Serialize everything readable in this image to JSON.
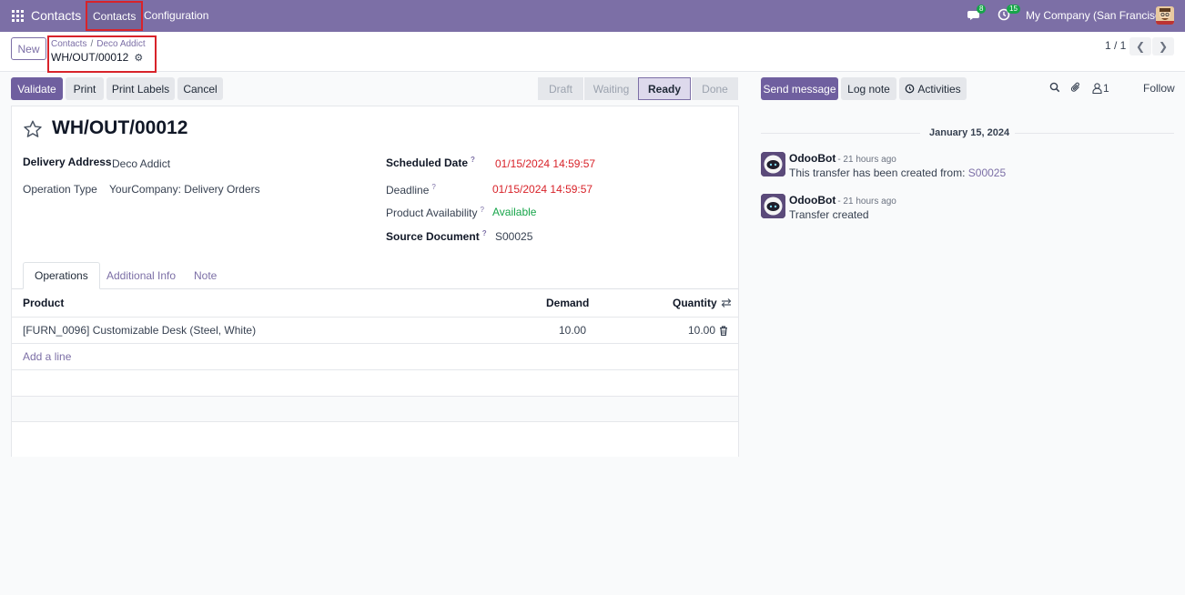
{
  "navbar": {
    "brand": "Contacts",
    "menu_contacts": "Contacts",
    "menu_configuration": "Configuration",
    "chat_badge": "8",
    "activity_badge": "15",
    "company": "My Company (San Francisco)"
  },
  "control": {
    "new_label": "New",
    "breadcrumb": [
      "Contacts",
      "Deco Addict"
    ],
    "record_ref": "WH/OUT/00012",
    "pager": "1 / 1"
  },
  "actions": {
    "validate": "Validate",
    "print": "Print",
    "print_labels": "Print Labels",
    "cancel": "Cancel"
  },
  "status": {
    "stages": [
      "Draft",
      "Waiting",
      "Ready",
      "Done"
    ],
    "current": "Ready"
  },
  "form": {
    "title": "WH/OUT/00012",
    "delivery_address_label": "Delivery Address",
    "delivery_address": "Deco Addict",
    "operation_type_label": "Operation Type",
    "operation_type": "YourCompany: Delivery Orders",
    "scheduled_date_label": "Scheduled Date",
    "scheduled_date": "01/15/2024 14:59:57",
    "deadline_label": "Deadline",
    "deadline": "01/15/2024 14:59:57",
    "availability_label": "Product Availability",
    "availability": "Available",
    "source_label": "Source Document",
    "source": "S00025",
    "help_mark": "?"
  },
  "tabs": [
    "Operations",
    "Additional Info",
    "Note"
  ],
  "operations": {
    "headers": {
      "product": "Product",
      "demand": "Demand",
      "quantity": "Quantity"
    },
    "rows": [
      {
        "product": "[FURN_0096] Customizable Desk (Steel, White)",
        "demand": "10.00",
        "quantity": "10.00"
      }
    ],
    "add_line": "Add a line"
  },
  "chatter": {
    "send_message": "Send message",
    "log_note": "Log note",
    "activities": "Activities",
    "followers_count": "1",
    "follow": "Follow",
    "date": "January 15, 2024",
    "messages": [
      {
        "author": "OdooBot",
        "time": "- 21 hours ago",
        "body": "This transfer has been created from: ",
        "link": "S00025"
      },
      {
        "author": "OdooBot",
        "time": "- 21 hours ago",
        "body": "Transfer created",
        "link": ""
      }
    ]
  }
}
